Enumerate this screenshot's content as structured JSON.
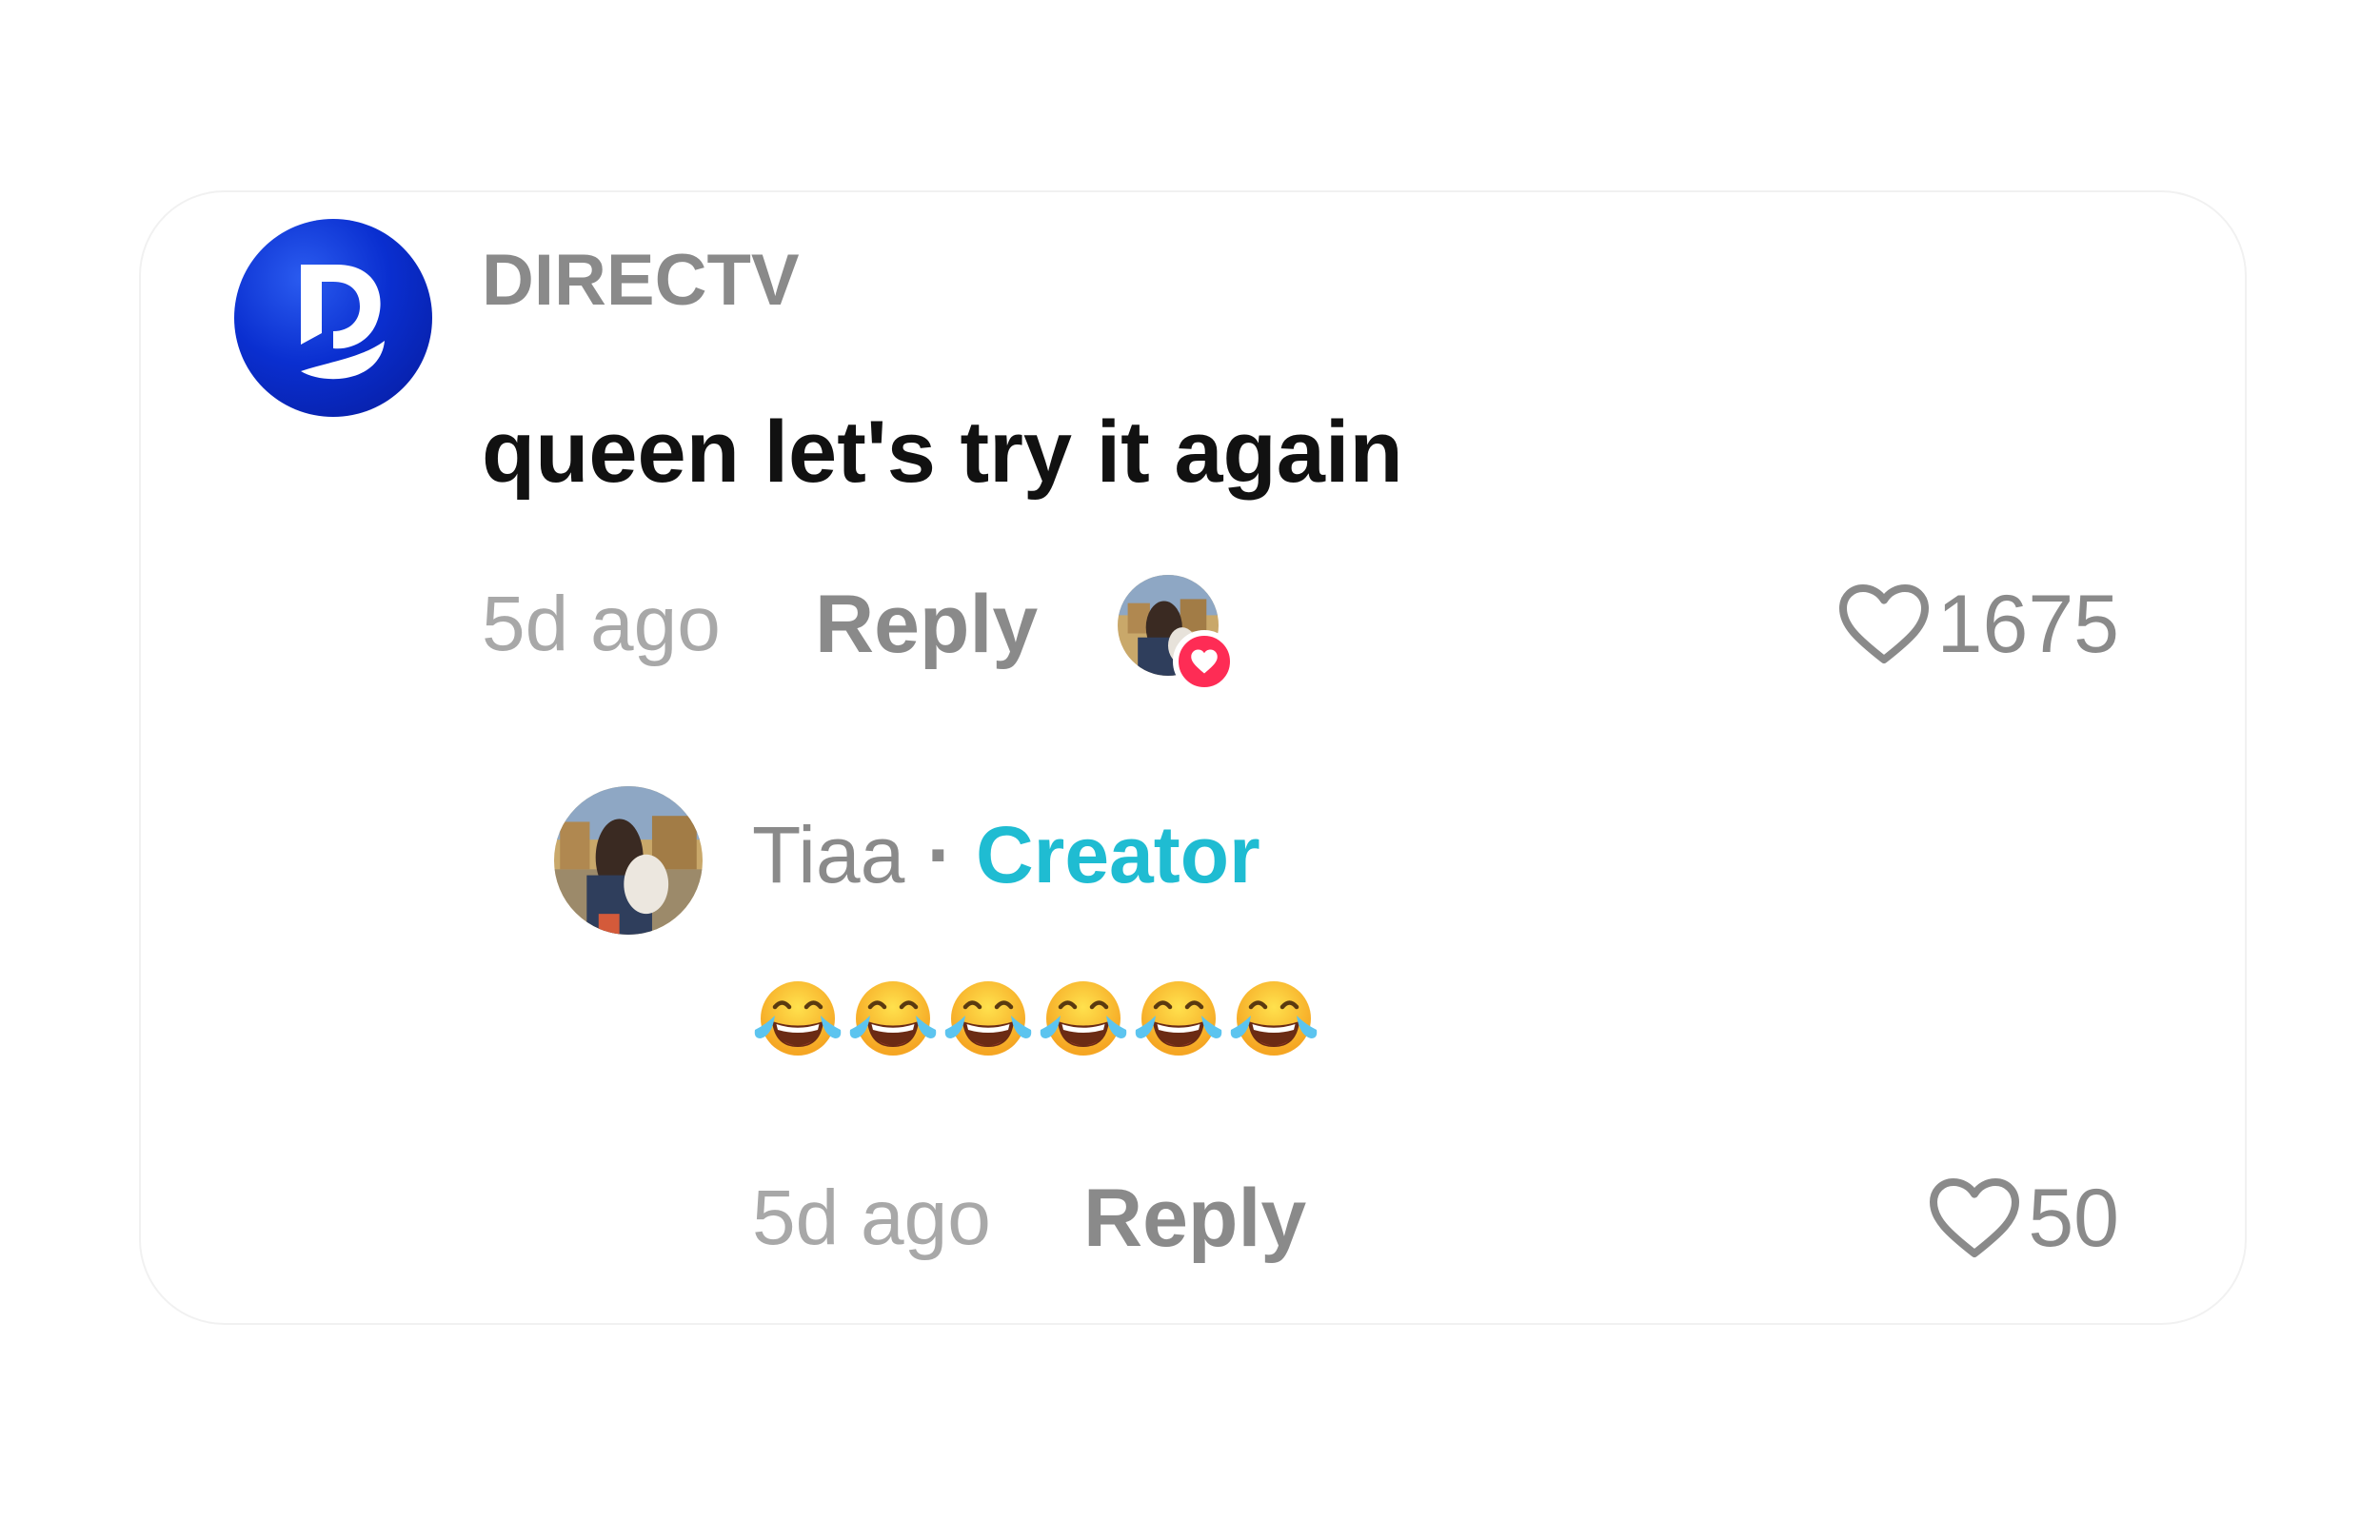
{
  "comment": {
    "username": "DIRECTV",
    "text": "queen let's try it again",
    "time": "5d ago",
    "reply_label": "Reply",
    "likes": "1675",
    "avatar_icon": "directv-logo-icon",
    "liked_by_creator_icon": "creator-liked-heart-icon"
  },
  "reply": {
    "username": "Tiaa",
    "separator": "·",
    "badge": "Creator",
    "emoji_count": 6,
    "emoji_icon": "face-with-tears-of-joy-icon",
    "time": "5d ago",
    "reply_label": "Reply",
    "likes": "50"
  },
  "colors": {
    "brand_blue": "#0a2fd0",
    "creator_badge": "#1fbcd2",
    "like_heart": "#fe2c55",
    "secondary_text": "#8a8a8a",
    "timestamp_text": "#a8a8a8"
  }
}
